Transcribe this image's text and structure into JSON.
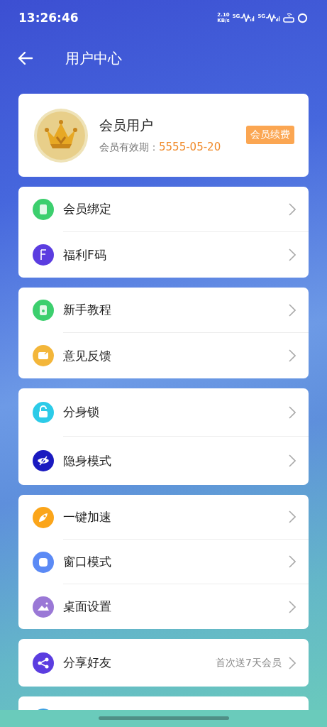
{
  "status_bar": {
    "time": "13:26:46",
    "speed": "2.10",
    "speed_unit": "KB/s",
    "network_1": "5G",
    "network_2": "5G"
  },
  "header": {
    "title": "用户中心"
  },
  "profile": {
    "name": "会员用户",
    "expiry_label": "会员有效期：",
    "expiry_date": "5555-05-20",
    "renew_button": "会员续费"
  },
  "groups": [
    {
      "items": [
        {
          "label": "会员绑定",
          "color": "#3ccf6e"
        },
        {
          "label": "福利F码",
          "color": "#5b3de0"
        }
      ]
    },
    {
      "items": [
        {
          "label": "新手教程",
          "color": "#3ccf6e"
        },
        {
          "label": "意见反馈",
          "color": "#f3b63a"
        }
      ]
    },
    {
      "items": [
        {
          "label": "分身锁",
          "color": "#2ccbe8"
        },
        {
          "label": "隐身模式",
          "color": "#1a1ac0"
        }
      ]
    },
    {
      "items": [
        {
          "label": "一键加速",
          "color": "#fba51a"
        },
        {
          "label": "窗口模式",
          "color": "#5b8af5"
        },
        {
          "label": "桌面设置",
          "color": "#9a78d6"
        }
      ]
    },
    {
      "items": [
        {
          "label": "分享好友",
          "color": "#5b3de0",
          "note": "首次送7天会员"
        }
      ]
    }
  ]
}
